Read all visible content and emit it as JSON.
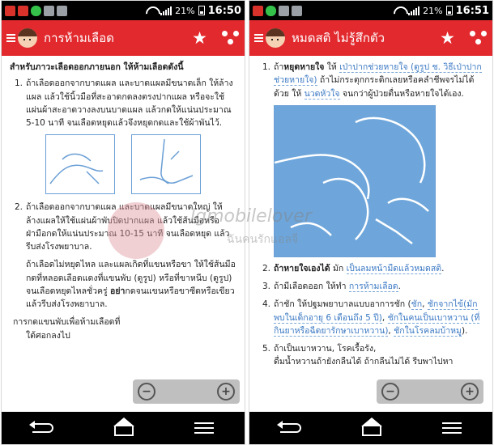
{
  "left": {
    "status": {
      "battery": "21%",
      "time": "16:50"
    },
    "app_bar": {
      "title": "การห้ามเลือด"
    },
    "heading": "สำหรับภาวะเลือดออกภายนอก ให้ห้ามเลือดดังนี้",
    "items": [
      {
        "num": "1.",
        "text": "ถ้าเลือดออกจากบาดแผล และบาดแผลมีขนาดเล็ก ให้ล้างแผล แล้วใช้นิ้วมือที่สะอาดกดลงตรงปากแผล หรือจะใช้แผ่นผ้าสะอาดวางลงบนบาดแผล แล้วกดให้แน่นประมาณ 5-10 นาที จนเลือดหยุดแล้วจึงหยุดกดและใช้ผ้าพันไว้."
      },
      {
        "num": "2.",
        "text": "ถ้าเลือดออกจากบาดแผล และบาดแผลมีขนาดใหญ่ ให้ล้างแผลให้ใช้แผ่นผ้าพับปิดปากแผล แล้วใช้ส้นมือหรือฝ่ามือกดให้แน่นประมาณ 10-15 นาที จนเลือดหยุด แล้วรีบส่งโรงพยาบาล."
      }
    ],
    "para_1a": "ถ้าเลือดไม่หยุดไหล และแผลเกิดที่แขนหรือขา ให้ใช้ส้นมือกดที่หลอดเลือดแดงที่แขนพับ (ดูรูป) หรือที่ขาหนีบ (ดูรูป) จนเลือดหยุดไหลชั่วครู่ ",
    "para_bold": "อย่า",
    "para_1b": "กดจนแขนหรือขาซีดหรือเขียว แล้วรีบส่งโรงพยาบาล.",
    "para_2": "การกดแขนพับเพื่อห้ามเลือดที่",
    "para_3": "ใต้ศอกลงไป"
  },
  "right": {
    "status": {
      "battery": "21%",
      "time": "16:51"
    },
    "app_bar": {
      "title": "หมดสติ ไม่รู้สึกตัว"
    },
    "item1": {
      "num": "1.",
      "prefix": "ถ้า",
      "bold": "หยุดหายใจ",
      "mid1": " ให้ ",
      "link1": "เป่าปากช่วยหายใจ (ดูรูป ช. วิธีเป่าปากช่วยหายใจ)",
      "mid2": " ถ้าไม่กระตุกกระดิกเลยหรือคลำชีพจรไม่ได้ด้วย ให้ ",
      "link2": "นวดหัวใจ",
      "tail": " จนกว่าผู้ป่วยตื่นหรือหายใจได้เอง."
    },
    "item2": {
      "num": "2.",
      "bold": "ถ้าหายใจเองได้",
      "mid": " มัก ",
      "link": "เป็นลมหน้ามืดแล้วหมดสติ",
      "tail": "."
    },
    "item3": {
      "num": "3.",
      "text": "ถ้ามีเลือดออก ให้ทำ ",
      "link": "การห้ามเลือด",
      "tail": "."
    },
    "item4": {
      "num": "4.",
      "text": "ถ้าชัก ให้ปฐมพยาบาลแบบอาการชัก (",
      "link1": "ชัก",
      "sep": ", ",
      "link2": "ชักจากไข้(มักพบในเด็กอายุ 6 เดือนถึง 5 ปี)",
      "sep2": ", ",
      "link3": "ชักในคนเป็นเบาหวาน (ที่กินยาหรือฉีดยารักษาเบาหวาน)",
      "sep3": ", ",
      "link4": "ชักในโรคลมบ้าหมู",
      "tail": ")."
    },
    "item5": {
      "num": "5.",
      "text": "ถ้าเป็นเบาหวาน, โรคเรื้อรัง,",
      "cont": "ดื่มน้ำหวานถ้ายังกลืนได้ ถ้ากลืนไม่ได้ รีบพาไปหา"
    }
  },
  "watermark": {
    "main": "lgmobilelover",
    "sub": "ฉันคนรักแอลจี"
  },
  "colors": {
    "accent": "#e2292e",
    "link": "#3a78c3",
    "figure_blue": "#6ea6db"
  }
}
